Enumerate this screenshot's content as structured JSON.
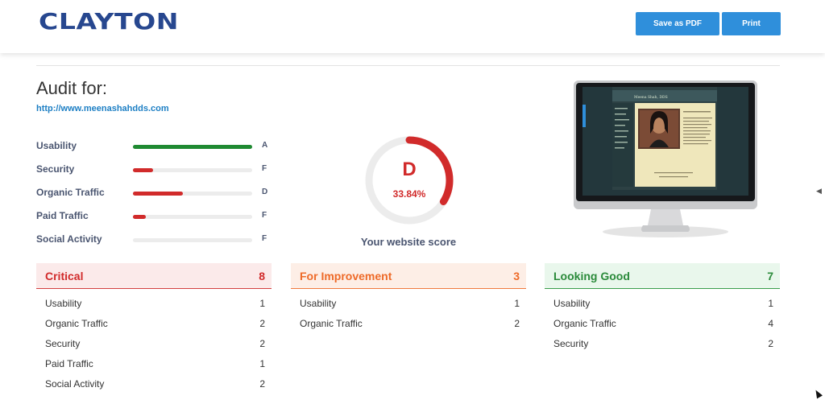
{
  "header": {
    "logo": "CLAYTON",
    "save_pdf_label": "Save as PDF",
    "print_label": "Print"
  },
  "audit": {
    "title": "Audit for:",
    "url": "http://www.meenashahdds.com"
  },
  "metrics": [
    {
      "label": "Usability",
      "grade": "A",
      "level": 1.0,
      "color": "#1f8a32"
    },
    {
      "label": "Security",
      "grade": "F",
      "level": 0.17,
      "color": "#d12b2b"
    },
    {
      "label": "Organic Traffic",
      "grade": "D",
      "level": 0.42,
      "color": "#d12b2b"
    },
    {
      "label": "Paid Traffic",
      "grade": "F",
      "level": 0.11,
      "color": "#d12b2b"
    },
    {
      "label": "Social Activity",
      "grade": "F",
      "level": 0.0,
      "color": "#d12b2b"
    }
  ],
  "score": {
    "letter": "D",
    "percent_text": "33.84%",
    "percent": 33.84,
    "caption": "Your website score",
    "color": "#d12b2b",
    "track_color": "#ececec"
  },
  "panels": {
    "critical": {
      "title": "Critical",
      "count": "8",
      "rows": [
        {
          "label": "Usability",
          "count": "1"
        },
        {
          "label": "Organic Traffic",
          "count": "2"
        },
        {
          "label": "Security",
          "count": "2"
        },
        {
          "label": "Paid Traffic",
          "count": "1"
        },
        {
          "label": "Social Activity",
          "count": "2"
        }
      ]
    },
    "improvement": {
      "title": "For Improvement",
      "count": "3",
      "rows": [
        {
          "label": "Usability",
          "count": "1"
        },
        {
          "label": "Organic Traffic",
          "count": "2"
        }
      ]
    },
    "good": {
      "title": "Looking Good",
      "count": "7",
      "rows": [
        {
          "label": "Usability",
          "count": "1"
        },
        {
          "label": "Organic Traffic",
          "count": "4"
        },
        {
          "label": "Security",
          "count": "2"
        }
      ]
    }
  },
  "preview": {
    "site_name": "Meena Shah, DDS"
  }
}
